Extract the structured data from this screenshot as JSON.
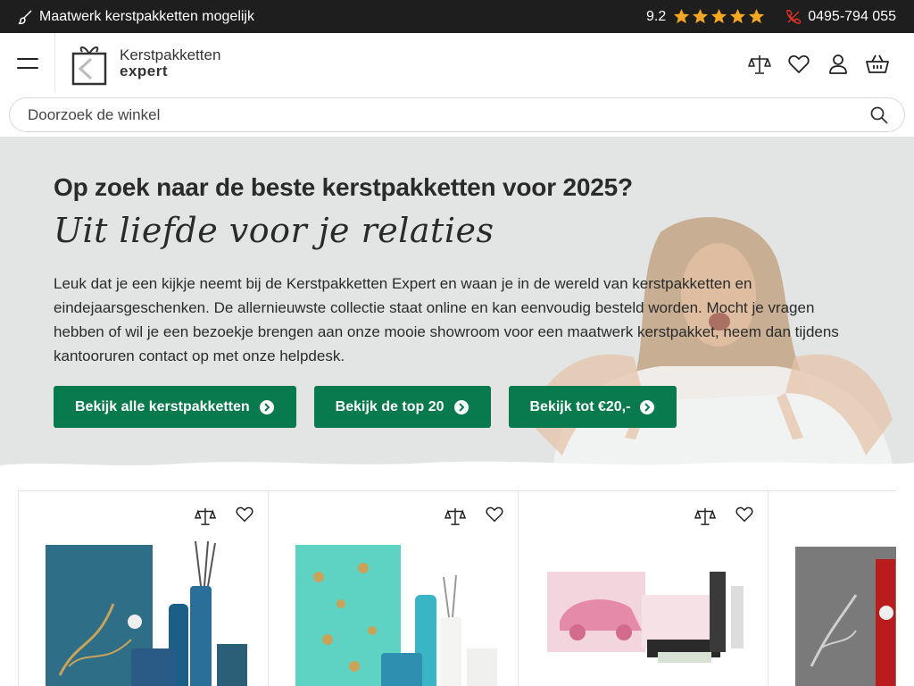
{
  "topbar": {
    "usp_text": "Maatwerk kerstpakketten mogelijk",
    "rating": "9.2",
    "stars": 5,
    "phone": "0495-794 055",
    "star_color": "#f5a623",
    "phone_icon_color": "#e0302a"
  },
  "header": {
    "logo_line1": "Kerstpakketten",
    "logo_line2": "expert",
    "icons": [
      "compare-icon",
      "heart-icon",
      "user-icon",
      "basket-icon"
    ]
  },
  "search": {
    "placeholder": "Doorzoek de winkel"
  },
  "hero": {
    "title": "Op zoek naar de beste kerstpakketten voor 2025?",
    "script": "Uit liefde voor je relaties",
    "text": "Leuk dat je een kijkje neemt bij de Kerstpakketten Expert en waan je in de wereld van kerstpakketten en eindejaarsgeschenken. De allernieuwste collectie staat online en kan eenvoudig besteld worden. Mocht je vragen hebben of wil je een bezoekje brengen aan onze mooie showroom voor een maatwerk kerstpakket, neem dan tijdens kantooruren contact op met onze helpdesk.",
    "buttons": [
      {
        "label": "Bekijk alle kerstpakketten"
      },
      {
        "label": "Bekijk de top 20"
      },
      {
        "label": "Bekijk tot €20,-"
      }
    ],
    "accent": "#087a4d",
    "background": "#e2e5e4"
  },
  "products": [
    {
      "name": "product-rituals-blue"
    },
    {
      "name": "product-rituals-turquoise"
    },
    {
      "name": "product-rituals-pink"
    },
    {
      "name": "product-rituals-grey"
    }
  ]
}
